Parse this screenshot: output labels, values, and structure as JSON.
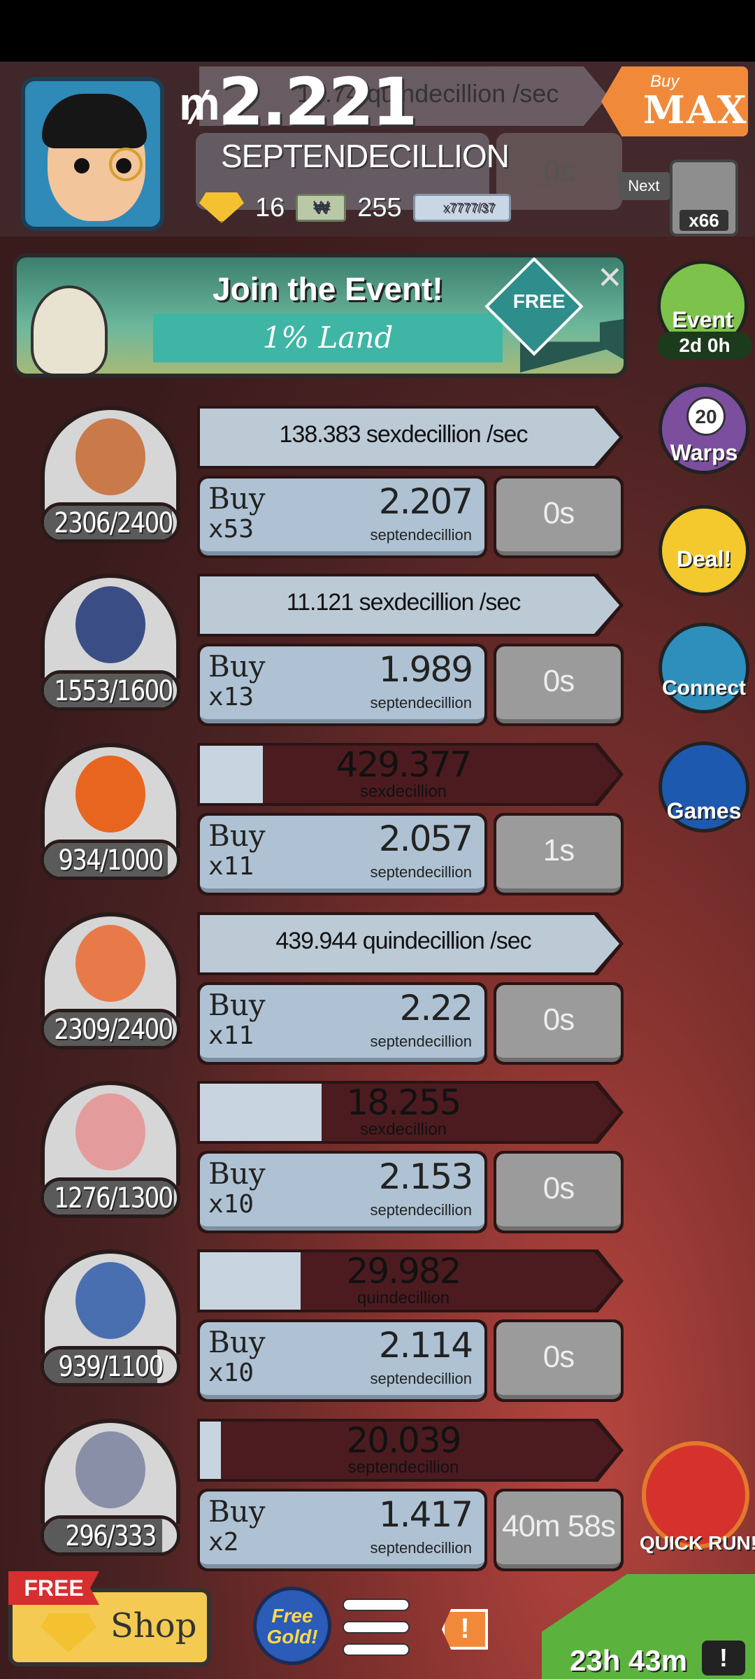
{
  "header": {
    "money_symbol": "₥",
    "money_value": "2.221",
    "money_unit": "SEPTENDECILLION",
    "ghost_rate": "10.74 quindecillion /sec",
    "ghost_time": "0s",
    "gold_count": "16",
    "megabucks_count": "255",
    "ticket_label": "x7777/37",
    "buy_max_small": "Buy",
    "buy_max_big": "MAX",
    "next_label": "Next",
    "next_count": "x66"
  },
  "event_banner": {
    "title": "Join the Event!",
    "subtitle": "1% Land",
    "free_label": "FREE",
    "close_icon": "close-icon"
  },
  "side_buttons": {
    "event_label": "Event",
    "event_time": "2d 0h",
    "warps_count": "20",
    "warps_label": "Warps",
    "deal_label": "Deal!",
    "connect_label": "Connect",
    "games_label": "Games",
    "quickrun_label": "QUICK RUN!"
  },
  "rows": [
    {
      "count": "2306/2400",
      "count_fill": 0.9608,
      "rate": "138.383 sexdecillion /sec",
      "buy_word": "Buy",
      "buy_mult": "x53",
      "cost": "2.207",
      "cost_unit": "septendecillion",
      "time": "0s",
      "portrait_color": "#c9794a"
    },
    {
      "count": "1553/1600",
      "count_fill": 0.9706,
      "rate": "11.121 sexdecillion /sec",
      "buy_word": "Buy",
      "buy_mult": "x13",
      "cost": "1.989",
      "cost_unit": "septendecillion",
      "time": "0s",
      "portrait_color": "#3a4e85"
    },
    {
      "count": "934/1000",
      "count_fill": 0.934,
      "progress_fill": 0.15,
      "progress_num": "429.377",
      "progress_unit": "sexdecillion",
      "buy_word": "Buy",
      "buy_mult": "x11",
      "cost": "2.057",
      "cost_unit": "septendecillion",
      "time": "1s",
      "portrait_color": "#e8651f"
    },
    {
      "count": "2309/2400",
      "count_fill": 0.9621,
      "rate": "439.944 quindecillion /sec",
      "buy_word": "Buy",
      "buy_mult": "x11",
      "cost": "2.22",
      "cost_unit": "septendecillion",
      "time": "0s",
      "portrait_color": "#e87a4a"
    },
    {
      "count": "1276/1300",
      "count_fill": 0.9815,
      "progress_fill": 0.29,
      "progress_num": "18.255",
      "progress_unit": "sexdecillion",
      "buy_word": "Buy",
      "buy_mult": "x10",
      "cost": "2.153",
      "cost_unit": "septendecillion",
      "time": "0s",
      "portrait_color": "#e49b9b"
    },
    {
      "count": "939/1100",
      "count_fill": 0.8536,
      "progress_fill": 0.24,
      "progress_num": "29.982",
      "progress_unit": "quindecillion",
      "buy_word": "Buy",
      "buy_mult": "x10",
      "cost": "2.114",
      "cost_unit": "septendecillion",
      "time": "0s",
      "portrait_color": "#4a6fb0"
    },
    {
      "count": "296/333",
      "count_fill": 0.8889,
      "progress_fill": 0.05,
      "progress_num": "20.039",
      "progress_unit": "septendecillion",
      "buy_word": "Buy",
      "buy_mult": "x2",
      "cost": "1.417",
      "cost_unit": "septendecillion",
      "time": "40m 58s",
      "portrait_color": "#8a8fa8"
    }
  ],
  "bottom": {
    "shop_free": "FREE",
    "shop_label": "Shop",
    "free_gold": "Free Gold!",
    "alert": "!",
    "timer": "23h 43m",
    "tv_icon": "!"
  }
}
